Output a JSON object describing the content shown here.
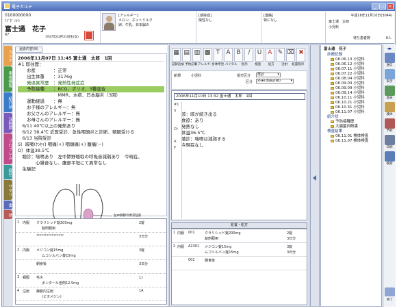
{
  "window": {
    "title": "電子カルテ",
    "controls": [
      "_",
      "□",
      "×"
    ]
  },
  "patient": {
    "id": "0100000000",
    "kana": "ﾌｼﾞﾀﾞ ﾊﾅｺ",
    "name": "富士通　花子",
    "sex_age": "67",
    "birth": "1937年03月31日生(女)",
    "allergy_title": "[アレルギー]",
    "allergy": [
      "メロン、ホットミルク",
      "卵、牛乳、日本脳炎"
    ],
    "infection_title": "[感染症]",
    "infection": "陽性なし",
    "contact_title": "[連絡]",
    "contact": "特になし",
    "date": "平成16年11月10日(3044)",
    "dept": "富士通　太郎",
    "ward": "小児科",
    "waiting_label": "待ち患者数",
    "waiting_count": "6人"
  },
  "vertical_tabs": [
    {
      "label": "カルテ",
      "color": "#e8a04a"
    },
    {
      "label": "患者情報",
      "color": "#4a9a4a"
    },
    {
      "label": "紹介状",
      "color": "#3a7cc8"
    },
    {
      "label": "注射歴",
      "color": "#7a5ab8"
    },
    {
      "label": "プロブレム",
      "color": "#c04a8a"
    },
    {
      "label": "病名",
      "color": "#3a9a9a"
    },
    {
      "label": "サマリ",
      "color": "#8a7a3a"
    },
    {
      "label": "書",
      "color": "#5a6ab8"
    },
    {
      "label": "状",
      "color": "#b85a5a"
    }
  ],
  "record": {
    "tab": "過去内容(N)",
    "header": "2006年11月07日 11:45 富士通　太郎　1回",
    "lines": [
      "#1 既往歴：",
      "　　お産　　　　：正常",
      "　　出生体重　　：3176g",
      "　　発達異常歴　：発熱性発症症",
      "　　予防接種　　：BCG、ポリオ、3種混合",
      "　　　　　　　　　MMR、水痘、日本脳炎（3回）",
      "　　運動経過　　：無",
      "　　お子様のアレルギー：無",
      "　　お父さんのアレルギー：無",
      "　　お母さんのアレルギー：無",
      "　6/11 40℃以上の発熱あり",
      "　6/12 38.4℃ 近医受診、急性咽頭炎と診断、頓服受ける",
      "　6/13 当院受診",
      "S）咳嗽(ｹﾝｾｲ) 咽痛(+) 咽頭痛(+) 腹痛(−)",
      "O）体温38.5℃",
      "　聴診：喘鳴あり　左中肺野聴取の呼吸音減弱あり　今現在、",
      "　　　　心雑音なし、腹部平坦にて異常なし",
      "　生験記"
    ],
    "diagram_caption": "左中肺野の異常陰影",
    "orders": [
      {
        "no": "1",
        "type": "内服",
        "drug": "クラリシッド錠200mg",
        "note": "錠剤服用",
        "qty": "2錠"
      },
      {
        "no": "",
        "type": "",
        "drug": "****************",
        "note": "",
        "qty": "3日分"
      },
      {
        "no": "2",
        "type": "内服",
        "drug": "メジコン錠15mg",
        "note": "ムコソルバン錠15mg",
        "qty": "3錠"
      },
      {
        "no": "",
        "type": "",
        "drug": "朝食後",
        "note": "",
        "qty": "3日分"
      },
      {
        "no": "3",
        "type": "頓服",
        "drug": "毛炎",
        "note": "ボンタール坐剤12.5mg",
        "qty": "1ｺ"
      },
      {
        "no": "4",
        "type": "注射",
        "drug": "静脈内注射",
        "note": "(ビタメジン)",
        "qty": "1A"
      }
    ]
  },
  "toolbar": {
    "buttons": [
      {
        "glyph": "▦",
        "label": "テンプレート"
      },
      {
        "glyph": "▤",
        "label": "シェーマ"
      },
      {
        "glyph": "▥",
        "label": "データ"
      },
      {
        "glyph": "▩",
        "label": "画像"
      },
      {
        "glyph": "T",
        "label": "文字"
      },
      {
        "glyph": "A",
        "label": "大"
      },
      {
        "glyph": "B",
        "label": "太字"
      },
      {
        "glyph": "/",
        "label": "斜体"
      },
      {
        "glyph": "U",
        "label": "下線"
      },
      {
        "glyph": "A",
        "label": "カラー"
      },
      {
        "glyph": "✎",
        "label": "一時"
      },
      {
        "glyph": "⌧",
        "label": "確定"
      },
      {
        "glyph": "✖",
        "label": "削除"
      }
    ],
    "row2": [
      "記録追加",
      "予約記載",
      "アレルギー",
      "身体所見",
      "バイタル",
      "指示",
      "検査",
      "処方",
      "注射",
      "処置指示"
    ]
  },
  "editor": {
    "visit_label": "新規",
    "dept": "小児科",
    "kind_label": "受付区分",
    "kind_value": "再診",
    "type_label": "区分",
    "type_value": "外来(当院診療)",
    "header": "2006年11月10日 13:32 富士通　太郎　1回",
    "margin_labels": [
      "#1",
      "S",
      "",
      "",
      "O）",
      "",
      "A",
      "P"
    ],
    "lines": [
      "咳：咳が続き出る",
      "食欲：あり",
      "発熱なし",
      "体温36.5℃",
      "聴診：喘鳴は減弱する",
      "今現在なし"
    ]
  },
  "orders_grid": {
    "header": "処置・処方",
    "rows": [
      {
        "no": "1",
        "type": "内服",
        "code": "001",
        "drug": "クラリシッド錠200mg",
        "drug2": "錠剤服用",
        "qty": "2錠",
        "days": "3日分"
      },
      {
        "no": "2",
        "type": "内服",
        "code": "A2301",
        "drug": "メジコン錠15mg",
        "drug2": "ムコソルバン錠15mg",
        "qty": "3錠",
        "days": "3日分"
      },
      {
        "no": "",
        "type": "",
        "code": "002",
        "drug": "朝食後",
        "drug2": "",
        "qty": "",
        "days": ""
      }
    ]
  },
  "tree": {
    "root": "富士通　花子",
    "groups": [
      {
        "label": "診療記録",
        "items": [
          "06.06.13 小児科",
          "06.06.12 小児科",
          "06.07.11 小児科",
          "06.07.22 小児科",
          "06.08.04 小児科",
          "06.09.03 小児科",
          "06.09.09 小児科",
          "06.09.14 小児科",
          "06.10.11 小児科",
          "06.10.21 小児科",
          "06.10.31 小児科",
          "06.11.07 小児科"
        ]
      },
      {
        "label": "紹介状",
        "items": [
          "予防接種歴",
          "大腸菌判断書"
        ]
      },
      {
        "label": "検査結果",
        "items": [
          "06.11.01 検体検査",
          "06.11.07 検体検査"
        ]
      }
    ]
  },
  "side_icons": [
    {
      "label": "送信",
      "color": "#6b87c4"
    },
    {
      "label": "表示",
      "color": "#7aa5d8"
    },
    {
      "label": "過去",
      "color": "#5b9a5b"
    },
    {
      "label": "検体",
      "color": "#c8a050"
    },
    {
      "label": "予約",
      "color": "#b05858"
    },
    {
      "label": "印刷",
      "color": "#6d7f9f"
    },
    {
      "label": "検索",
      "color": "#5a7fb8"
    }
  ],
  "finish_label": "終了",
  "colors": {
    "highlight": "#9bcc62",
    "title": "#5a7bc2",
    "panel_border": "#9aa8c3"
  }
}
